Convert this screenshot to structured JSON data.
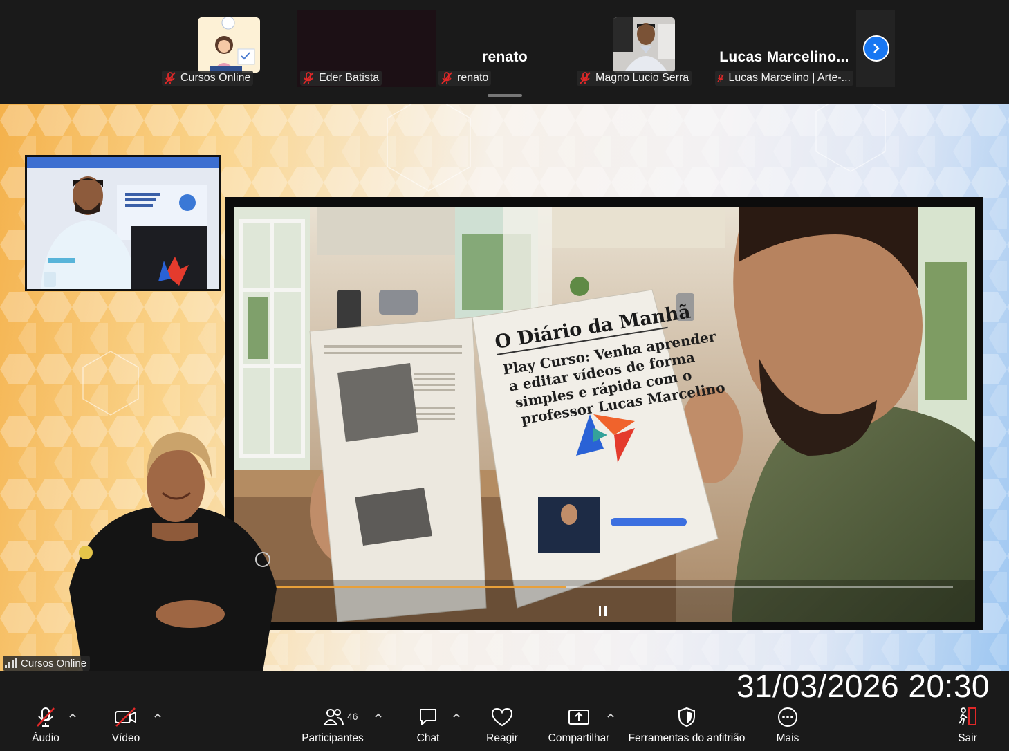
{
  "participants": [
    {
      "name": "Cursos Online",
      "display_name": "",
      "muted": true
    },
    {
      "name": "Eder Batista",
      "display_name": "",
      "muted": true
    },
    {
      "name": "renato",
      "display_name": "renato",
      "muted": true
    },
    {
      "name": "Magno Lucio Serra",
      "display_name": "",
      "muted": true
    },
    {
      "name": "Lucas Marcelino | Arte-...",
      "display_name": "Lucas  Marcelino...",
      "muted": true
    }
  ],
  "stage": {
    "label": "Cursos Online",
    "newspaper": {
      "masthead": "O Diário da Manhã",
      "headline_lines": [
        "Play Curso: Venha aprender",
        "a editar vídeos de forma",
        "simples e rápida com o",
        "professor Lucas Marcelino"
      ]
    }
  },
  "timestamp": "31/03/2026 20:30",
  "toolbar": {
    "audio": "Áudio",
    "video": "Vídeo",
    "participants": "Participantes",
    "participants_count": "46",
    "chat": "Chat",
    "react": "Reagir",
    "share": "Compartilhar",
    "host_tools": "Ferramentas do anfitrião",
    "more": "Mais",
    "leave": "Sair"
  },
  "colors": {
    "accent": "#1877f2",
    "mute_red": "#e02828",
    "leave_red": "#e02828"
  }
}
